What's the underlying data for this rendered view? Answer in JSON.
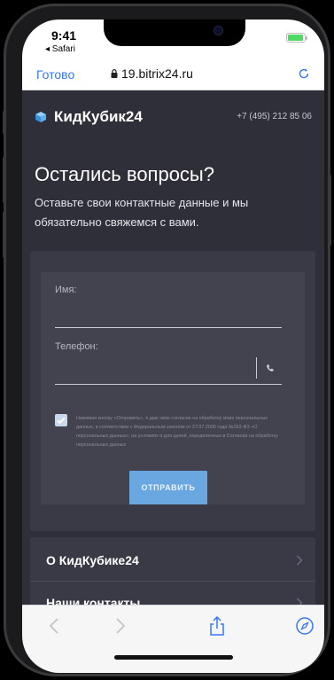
{
  "status_bar": {
    "time": "9:41",
    "back_app": "◂ Safari",
    "battery_color": "#4cd964"
  },
  "safari": {
    "done_label": "Готово",
    "url": "19.bitrix24.ru",
    "accent": "#3478f6"
  },
  "header": {
    "brand": "КидКубик24",
    "phone": "+7 (495) 212 85 06",
    "brand_icon": "cube-icon"
  },
  "hero": {
    "title": "Остались вопросы?",
    "subtitle": "Оставьте свои контактные данные и мы обязательно свяжемся с вами."
  },
  "form": {
    "name_label": "Имя:",
    "name_value": "",
    "phone_label": "Телефон:",
    "phone_value": "",
    "consent_checked": true,
    "consent_text": "Нажимая кнопку «Отправить», я даю свое согласие на обработку моих персональных данных, в соответствии с Федеральным законом от 27.07.2006 года №152-ФЗ «О персональных данных», на условиях и для целей, определенных в Согласии на обработку персональных данных",
    "submit_label": "ОТПРАВИТЬ",
    "submit_color": "#6aa7e0"
  },
  "menu": {
    "items": [
      {
        "label": "О КидКубике24"
      },
      {
        "label": "Наши контакты"
      }
    ]
  },
  "toolbar": {
    "icons": [
      "back-icon",
      "forward-icon",
      "share-icon",
      "compass-icon"
    ]
  }
}
